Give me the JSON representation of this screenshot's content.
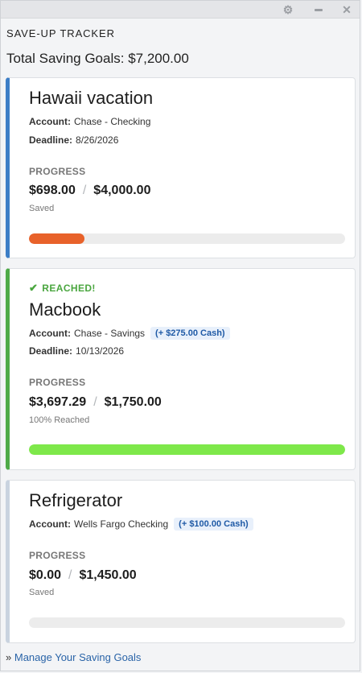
{
  "window": {
    "icons": [
      "gear-icon",
      "minimize-icon",
      "close-icon"
    ]
  },
  "app_title": "SAVE-UP TRACKER",
  "total_label": "Total Saving Goals: $7,200.00",
  "colors": {
    "blue_accent": "#3d7ec6",
    "green_accent": "#4faa48",
    "grey_accent": "#c9d3df",
    "orange_fill": "#e8622a",
    "green_fill": "#7ee84a",
    "link": "#2a64a8"
  },
  "goals": [
    {
      "title": "Hawaii vacation",
      "account_label": "Account:",
      "account": "Chase - Checking",
      "deadline_label": "Deadline:",
      "deadline": "8/26/2026",
      "progress_label": "PROGRESS",
      "saved": "$698.00",
      "separator": "/",
      "goal": "$4,000.00",
      "status": "Saved",
      "progress_fraction": 0.1745
    },
    {
      "badge": "REACHED!",
      "title": "Macbook",
      "account_label": "Account:",
      "account": "Chase - Savings",
      "cash": "(+ $275.00 Cash)",
      "deadline_label": "Deadline:",
      "deadline": "10/13/2026",
      "progress_label": "PROGRESS",
      "saved": "$3,697.29",
      "separator": "/",
      "goal": "$1,750.00",
      "status": "100% Reached",
      "progress_fraction": 1.0
    },
    {
      "title": "Refrigerator",
      "account_label": "Account:",
      "account": "Wells Fargo Checking",
      "cash": "(+ $100.00 Cash)",
      "progress_label": "PROGRESS",
      "saved": "$0.00",
      "separator": "/",
      "goal": "$1,450.00",
      "status": "Saved",
      "progress_fraction": 0.0
    }
  ],
  "footer": {
    "prefix": "»",
    "link_text": "Manage Your Saving Goals"
  }
}
